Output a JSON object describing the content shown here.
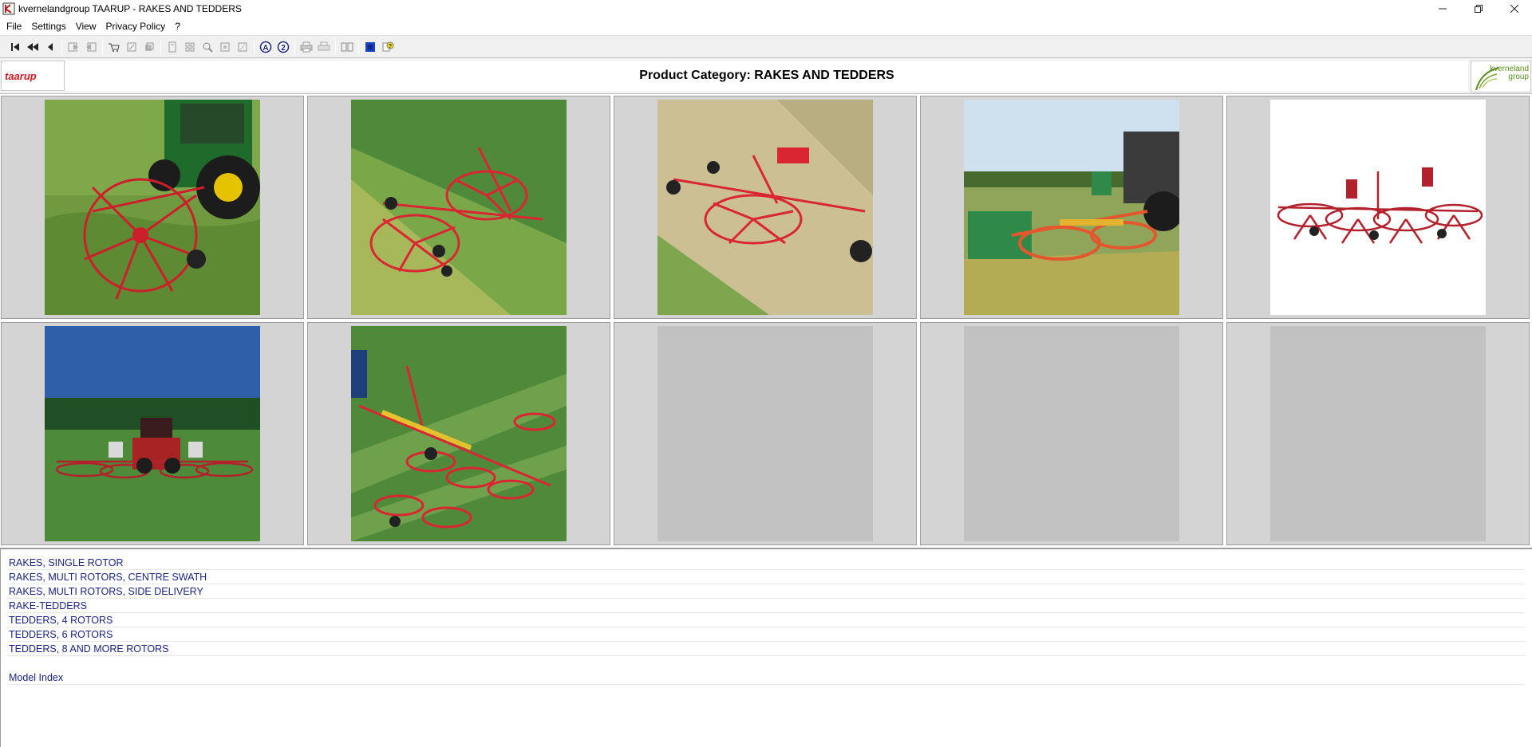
{
  "window": {
    "title": "kvernelandgroup TAARUP - RAKES AND TEDDERS",
    "controls": [
      "minimize",
      "restore",
      "close"
    ]
  },
  "menu": {
    "items": [
      "File",
      "Settings",
      "View",
      "Privacy Policy",
      "?"
    ]
  },
  "toolbar": {
    "buttons": [
      "first-page-icon",
      "previous-section-icon",
      "previous-icon",
      "back-icon",
      "forward-icon",
      "cart-icon",
      "edit-icon",
      "stack-icon",
      "page-icon",
      "grid-icon",
      "zoom-icon",
      "copy-icon",
      "paste-icon",
      "search-a-icon",
      "search-2-icon",
      "print-icon",
      "print-preview-icon",
      "book-icon",
      "color-icon",
      "help-icon"
    ]
  },
  "header": {
    "title": "Product Category: RAKES AND TEDDERS",
    "left_logo": "taarup",
    "right_logo": "kverneland group"
  },
  "grid": {
    "tiles": [
      {
        "image": "rake-behind-tractor",
        "filled": true
      },
      {
        "image": "multi-rotor-rake-field",
        "filled": true
      },
      {
        "image": "rake-on-stubble",
        "filled": true
      },
      {
        "image": "rake-side-delivery-sky",
        "filled": true
      },
      {
        "image": "tedder-white-background",
        "filled": true
      },
      {
        "image": "tedder-rear-view-forest",
        "filled": true
      },
      {
        "image": "wide-tedder-field",
        "filled": true
      },
      {
        "image": "",
        "filled": false
      },
      {
        "image": "",
        "filled": false
      },
      {
        "image": "",
        "filled": false
      }
    ]
  },
  "categories": [
    "RAKES, SINGLE ROTOR",
    "RAKES, MULTI ROTORS, CENTRE SWATH",
    "RAKES, MULTI ROTORS, SIDE DELIVERY",
    "RAKE-TEDDERS",
    "TEDDERS, 4 ROTORS",
    "TEDDERS, 6 ROTORS",
    "TEDDERS, 8 AND MORE ROTORS"
  ],
  "model_index": "Model Index",
  "colors": {
    "link": "#1a237e",
    "machine_red": "#d32f2f",
    "tile_bg": "#d4d4d4"
  }
}
